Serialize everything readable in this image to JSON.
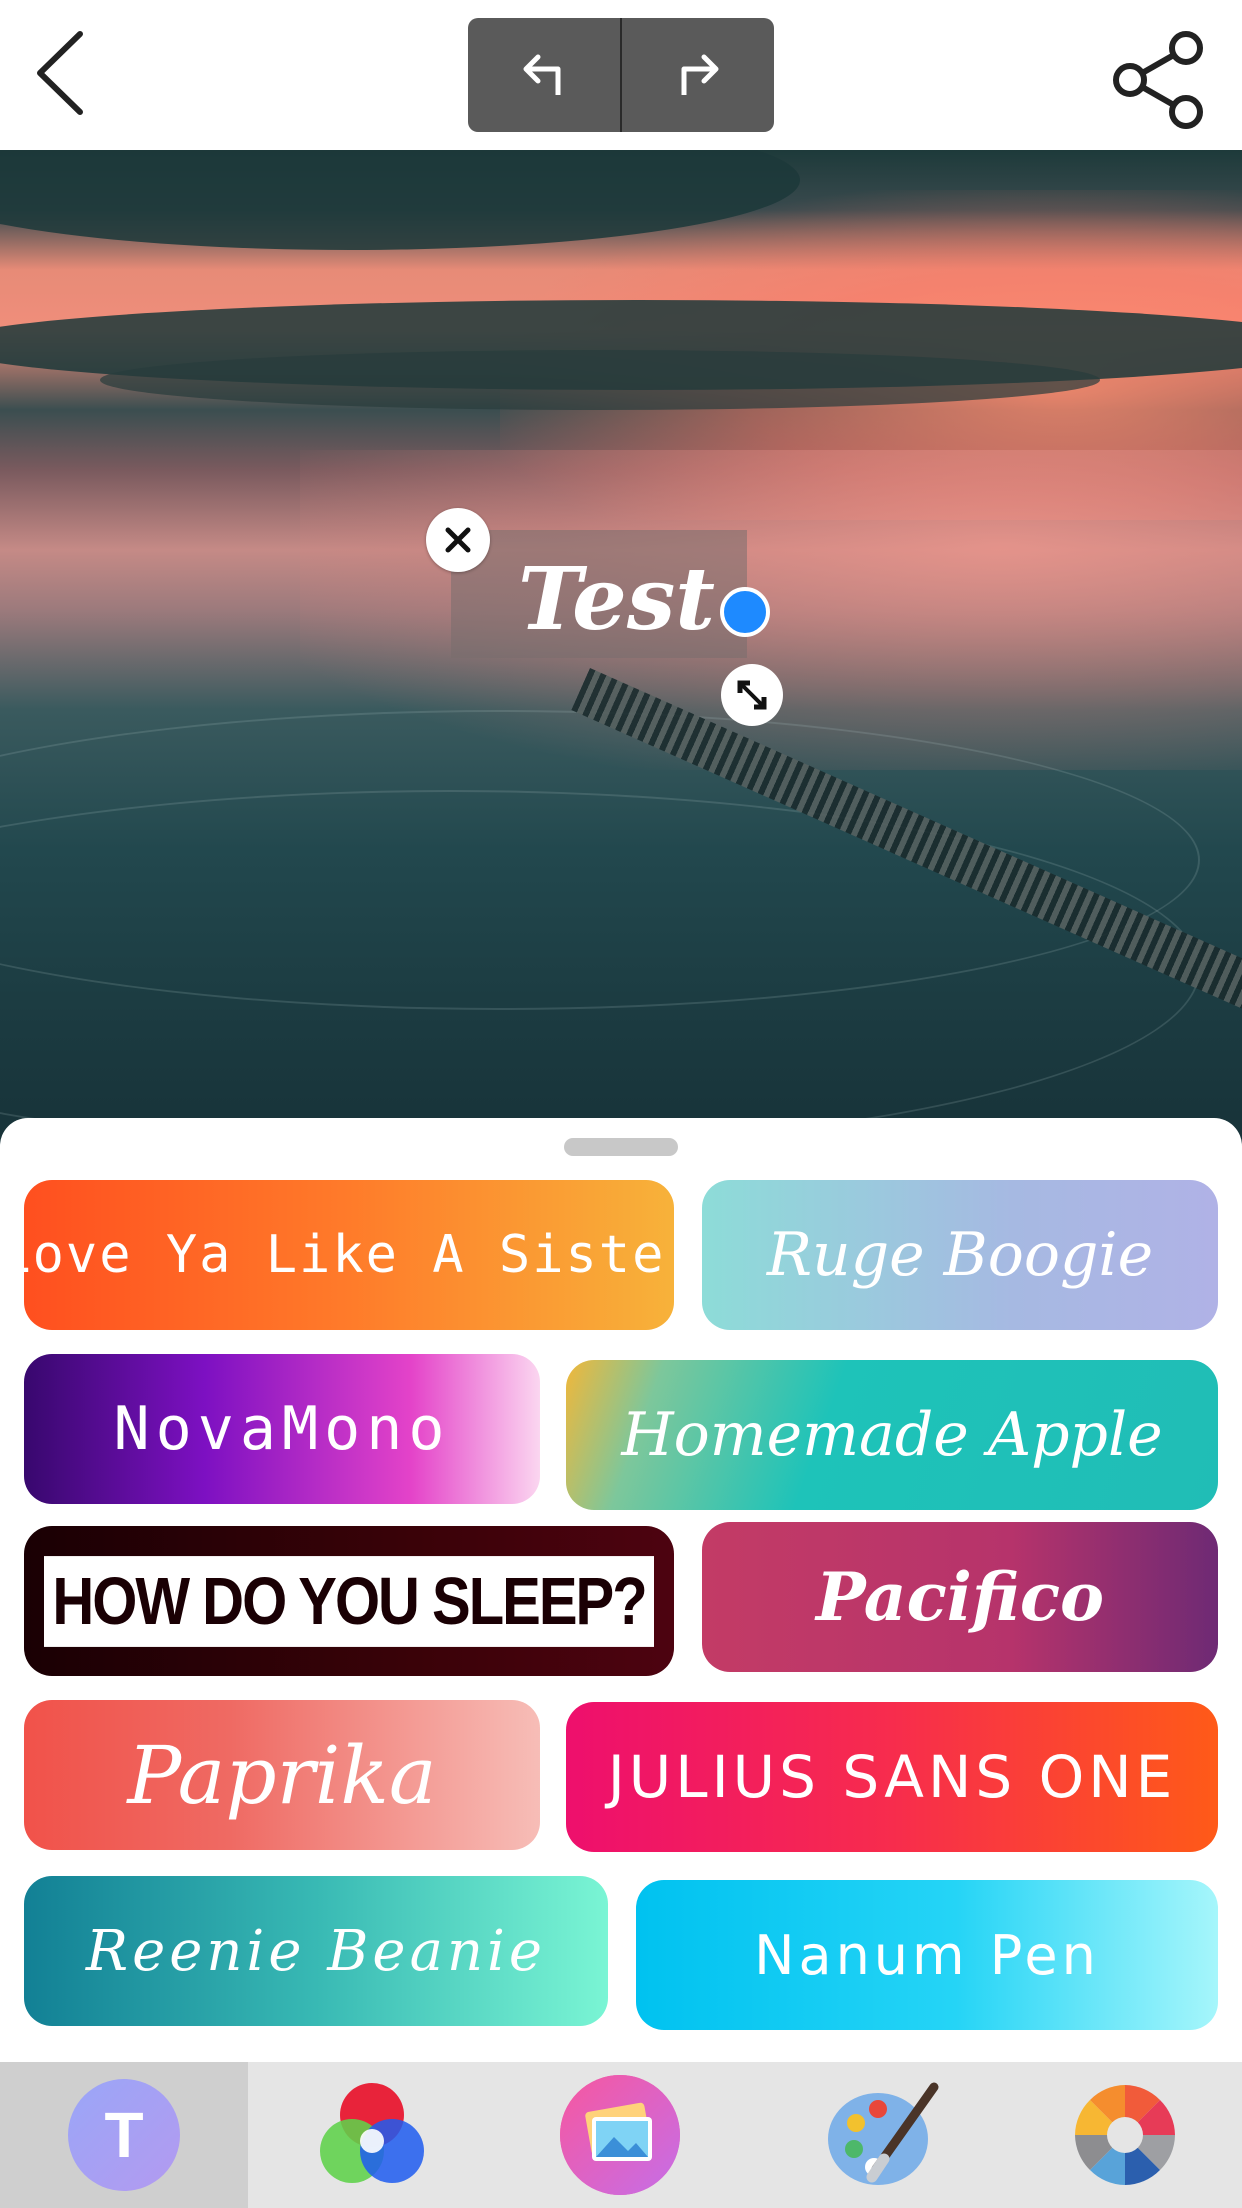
{
  "header": {
    "back_icon": "chevron-left-icon",
    "undo_icon": "undo-arrow-icon",
    "redo_icon": "redo-arrow-icon",
    "share_icon": "share-icon"
  },
  "canvas": {
    "overlay_text": "Test",
    "text_color": "#ffffff",
    "color_handle_color": "#1e8aff"
  },
  "font_picker": {
    "fonts": [
      {
        "label": "Love Ya Like A Sister"
      },
      {
        "label": "Ruge Boogie"
      },
      {
        "label": "NovaMono"
      },
      {
        "label": "Homemade Apple"
      },
      {
        "label": "HOW DO YOU SLEEP?"
      },
      {
        "label": "Pacifico"
      },
      {
        "label": "Paprika"
      },
      {
        "label": "JULIUS SANS ONE"
      },
      {
        "label": "Reenie Beanie"
      },
      {
        "label": "Nanum Pen"
      }
    ]
  },
  "toolbar": {
    "tools": [
      {
        "icon": "text-t-icon",
        "glyph": "T",
        "active": true
      },
      {
        "icon": "color-circles-icon",
        "active": false
      },
      {
        "icon": "photos-icon",
        "active": false
      },
      {
        "icon": "paint-palette-icon",
        "active": false
      },
      {
        "icon": "color-wheel-icon",
        "active": false
      }
    ]
  }
}
